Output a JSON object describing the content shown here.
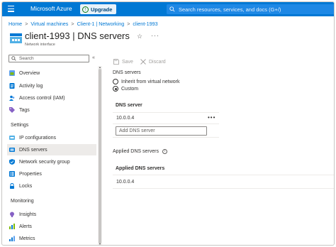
{
  "topbar": {
    "brand": "Microsoft Azure",
    "upgrade_label": "Upgrade",
    "search_placeholder": "Search resources, services, and docs (G+/)"
  },
  "breadcrumb": [
    "Home",
    "Virtual machines",
    "Client-1 | Networking",
    "client-1993"
  ],
  "header": {
    "title": "client-1993 | DNS servers",
    "subtitle": "Network interface"
  },
  "sidebar": {
    "search_placeholder": "Search",
    "collapse_glyph": "«",
    "items_top": [
      {
        "label": "Overview",
        "icon": "overview-icon"
      },
      {
        "label": "Activity log",
        "icon": "activity-log-icon"
      },
      {
        "label": "Access control (IAM)",
        "icon": "access-control-icon"
      },
      {
        "label": "Tags",
        "icon": "tag-icon"
      }
    ],
    "settings_header": "Settings",
    "settings_items": [
      {
        "label": "IP configurations",
        "icon": "ip-config-icon"
      },
      {
        "label": "DNS servers",
        "icon": "dns-icon",
        "active": true
      },
      {
        "label": "Network security group",
        "icon": "nsg-icon"
      },
      {
        "label": "Properties",
        "icon": "properties-icon"
      },
      {
        "label": "Locks",
        "icon": "lock-icon"
      }
    ],
    "monitoring_header": "Monitoring",
    "monitoring_items": [
      {
        "label": "Insights",
        "icon": "insights-icon"
      },
      {
        "label": "Alerts",
        "icon": "alerts-icon"
      },
      {
        "label": "Metrics",
        "icon": "metrics-icon"
      }
    ]
  },
  "toolbar": {
    "save_label": "Save",
    "discard_label": "Discard"
  },
  "dns": {
    "label": "DNS servers",
    "options": [
      {
        "label": "Inherit from virtual network",
        "checked": false
      },
      {
        "label": "Custom",
        "checked": true
      }
    ],
    "table_header": "DNS server",
    "servers": [
      "10.0.0.4"
    ],
    "add_placeholder": "Add DNS server",
    "more_glyph": "•••"
  },
  "applied": {
    "label": "Applied DNS servers",
    "table_header": "Applied DNS servers",
    "servers": [
      "10.0.0.4"
    ]
  },
  "colors": {
    "accent": "#0078d4",
    "active_bg": "#edebe9"
  }
}
